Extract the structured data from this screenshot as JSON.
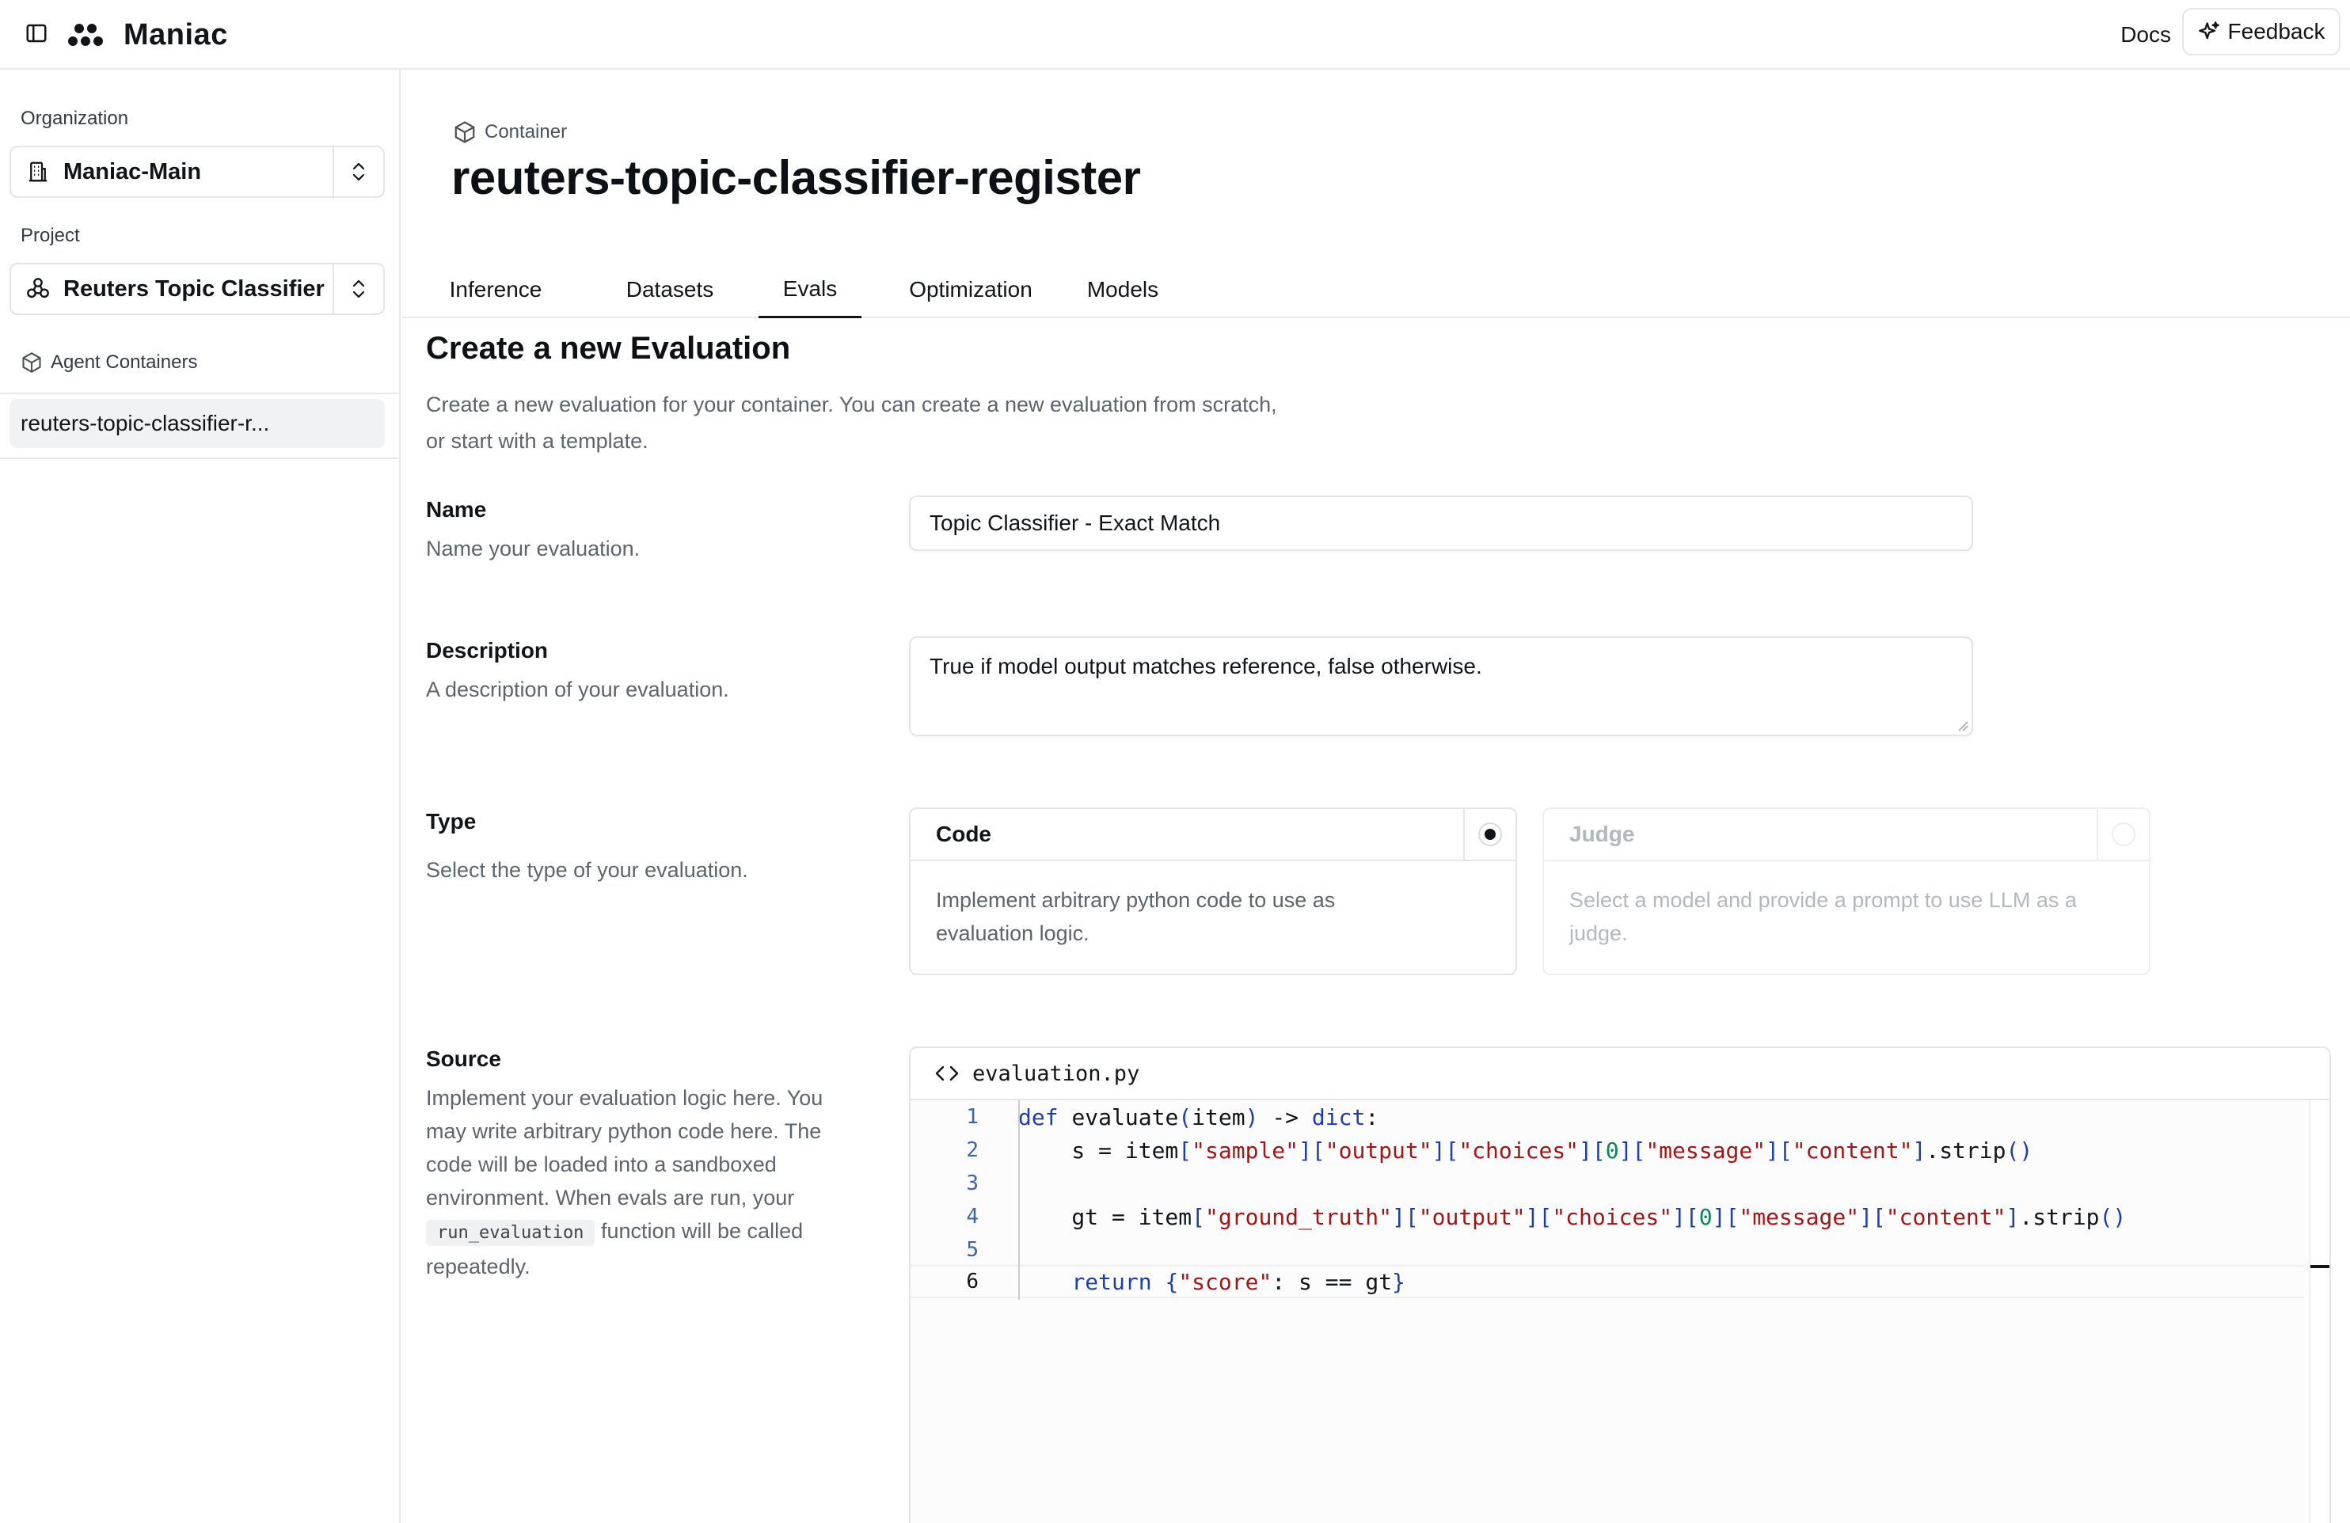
{
  "app": {
    "name": "Maniac",
    "docs_label": "Docs",
    "feedback_label": "Feedback"
  },
  "sidebar": {
    "org_label": "Organization",
    "org_value": "Maniac-Main",
    "project_label": "Project",
    "project_value": "Reuters Topic Classifier",
    "containers_label": "Agent Containers",
    "container_item": "reuters-topic-classifier-r..."
  },
  "header": {
    "crumb": "Container",
    "title": "reuters-topic-classifier-register"
  },
  "tabs": [
    {
      "label": "Inference"
    },
    {
      "label": "Datasets"
    },
    {
      "label": "Evals"
    },
    {
      "label": "Optimization"
    },
    {
      "label": "Models"
    }
  ],
  "active_tab": "Evals",
  "form": {
    "title": "Create a new Evaluation",
    "description_line1": "Create a new evaluation for your container. You can create a new evaluation from scratch,",
    "description_line2": "or start with a template.",
    "name": {
      "label": "Name",
      "help": "Name your evaluation.",
      "value": "Topic Classifier - Exact Match"
    },
    "description": {
      "label": "Description",
      "help": "A description of your evaluation.",
      "value": "True if model output matches reference, false otherwise."
    },
    "type": {
      "label": "Type",
      "help": "Select the type of your evaluation.",
      "selected": "Code",
      "options": [
        {
          "title": "Code",
          "desc_line1": "Implement arbitrary python code to use as",
          "desc_line2": "evaluation logic."
        },
        {
          "title": "Judge",
          "desc_line1": "Select a model and provide a prompt to use LLM as a",
          "desc_line2": "judge."
        }
      ]
    },
    "source": {
      "label": "Source",
      "help_line1": "Implement your evaluation logic here. You",
      "help_line2": "may write arbitrary python code here. The",
      "help_line3": "code will be loaded into a sandboxed",
      "help_line4": "environment. When evals are run, your",
      "help_code": "run_evaluation",
      "help_line5_tail": "function will be called",
      "help_line6": "repeatedly.",
      "filename": "evaluation.py",
      "line_numbers": [
        "1",
        "2",
        "3",
        "4",
        "5",
        "6"
      ],
      "code_lines": [
        "def evaluate(item) -> dict:",
        "    s = item[\"sample\"][\"output\"][\"choices\"][0][\"message\"][\"content\"].strip()",
        "",
        "    gt = item[\"ground_truth\"][\"output\"][\"choices\"][0][\"message\"][\"content\"].strip()",
        "",
        "    return {\"score\": s == gt}"
      ]
    }
  },
  "icons": {
    "sidebar_toggle": "sidebar-panel-icon",
    "logo": "maniac-logo-icon",
    "feedback": "sparkle-icon",
    "org": "building-icon",
    "project": "network-icon",
    "container": "cube-icon",
    "chevrons": "chevrons-up-down-icon",
    "code": "code-brackets-icon"
  }
}
